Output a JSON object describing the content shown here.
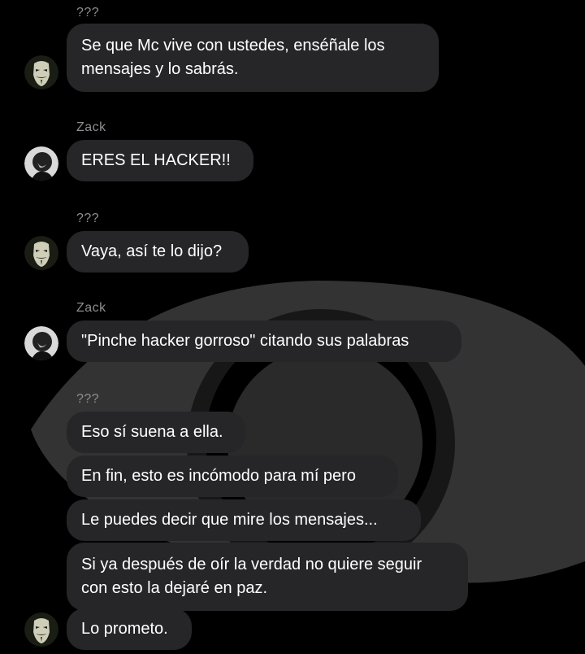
{
  "chat": {
    "groups": [
      {
        "sender": "???",
        "avatar_icon": "anonymous-mask-icon",
        "messages": [
          "Se que Mc vive con ustedes, enséñale los",
          "mensajes y lo sabrás."
        ]
      },
      {
        "sender": "Zack",
        "avatar_icon": "zack-profile-icon",
        "messages": [
          "ERES EL HACKER!!"
        ]
      },
      {
        "sender": "???",
        "avatar_icon": "anonymous-mask-icon",
        "messages": [
          "Vaya, así te lo dijo?"
        ]
      },
      {
        "sender": "Zack",
        "avatar_icon": "zack-profile-icon",
        "messages": [
          "\"Pinche hacker gorroso\" citando sus palabras"
        ]
      },
      {
        "sender": "???",
        "avatar_icon": "anonymous-mask-icon",
        "messages": [
          "Eso sí suena a ella.",
          "En fin, esto es incómodo para mí pero",
          "Le puedes decir que mire los mensajes...",
          "Si ya después de oír la verdad no quiere seguir",
          "con esto la dejaré en paz.",
          "Lo prometo."
        ]
      }
    ]
  },
  "background": {
    "icon": "eye-icon",
    "color": "#333333"
  },
  "colors": {
    "bubble": "#262629",
    "sender": "#8e8e93",
    "text": "#ffffff",
    "background": "#000000"
  }
}
